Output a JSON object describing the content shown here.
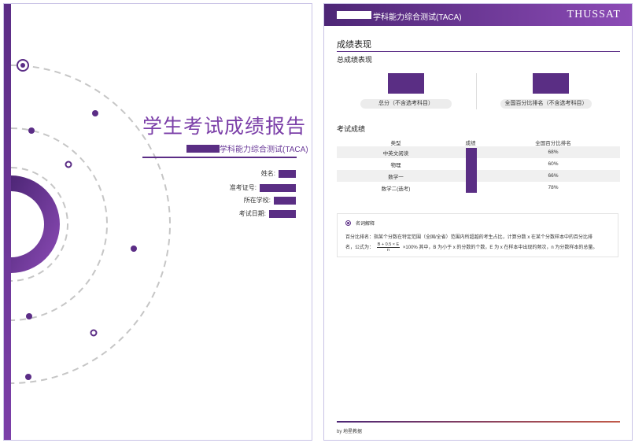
{
  "cover": {
    "title": "学生考试成绩报告",
    "subtitle": "学科能力综合测试(TACA)",
    "fields": [
      "姓名:",
      "准考证号:",
      "所在学校:",
      "考试日期:"
    ]
  },
  "report": {
    "header_title": "学科能力综合测试(TACA)",
    "brand": "THUSSAT",
    "section_title": "成绩表现",
    "overall_title": "总成绩表现",
    "total_label": "总分（不含选考科目）",
    "rank_label": "全国百分比排名（不含选考科目）",
    "exam_title": "考试成绩",
    "table_headers": [
      "类型",
      "成绩",
      "全国百分比排名"
    ],
    "rows": [
      {
        "subject": "中英文阅读",
        "percentile": "68%"
      },
      {
        "subject": "物理",
        "percentile": "60%"
      },
      {
        "subject": "数学一",
        "percentile": "66%"
      },
      {
        "subject": "数学二(选考)",
        "percentile": "78%"
      }
    ],
    "note": {
      "head": "名词解释",
      "line1": "百分比排名：指某个分数在特定范围（全国/全省）范围内所超越的考生占比，计算分数 x 在某个分数样本中的百分比排",
      "line2_prefix": "名，公式为：",
      "frac_num": "B + 0.5 × E",
      "frac_den": "n",
      "line2_suffix": "×100% 其中，B 为小于 x 的分数的个数，E 为 x 在样本中出现的频次，n 为分数样本的总量。"
    },
    "footer": "by 地星教据"
  },
  "colors": {
    "accent": "#5b2d86",
    "accent_light": "#8c4bb6",
    "footer_end": "#c15a49"
  }
}
